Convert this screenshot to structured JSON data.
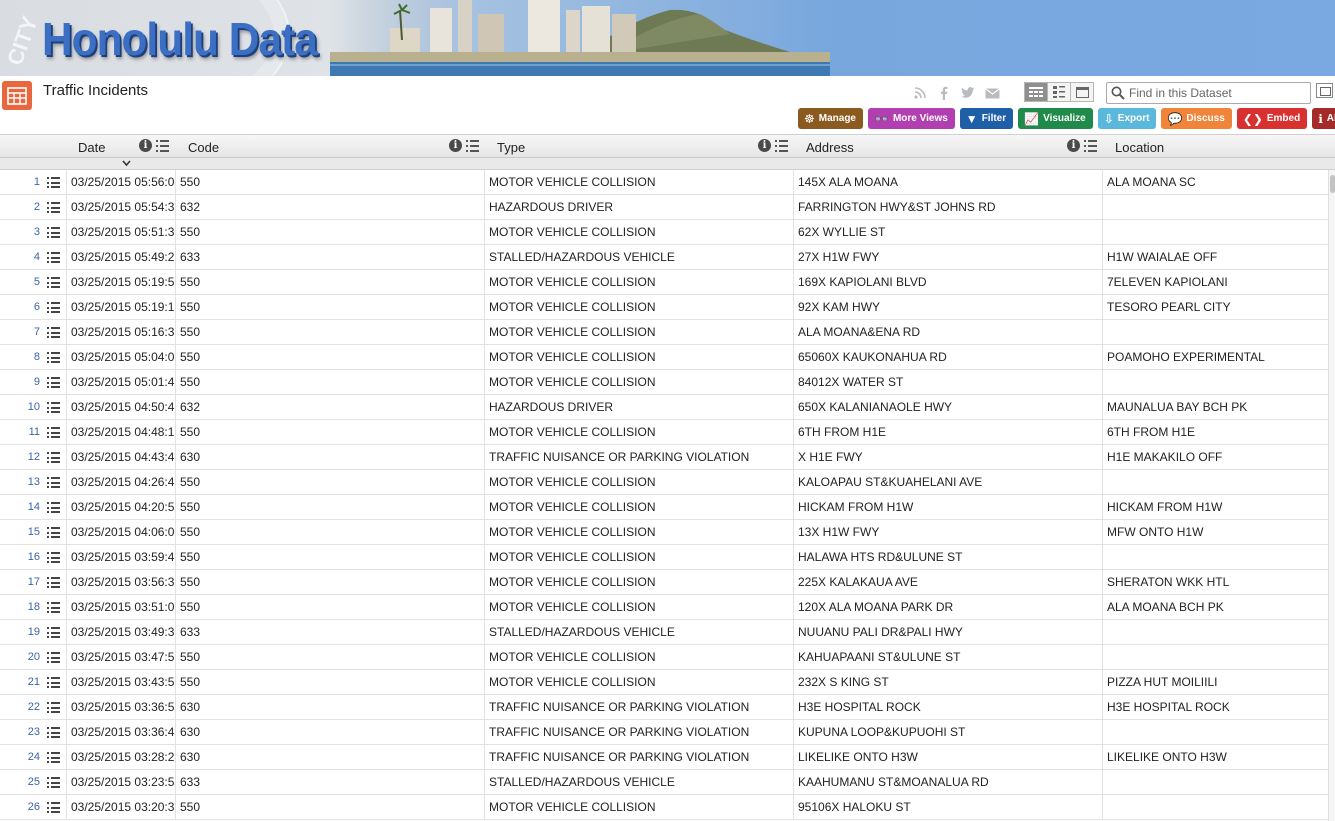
{
  "banner": {
    "title": "Honolulu Data",
    "seal_text": "CITY"
  },
  "page": {
    "title": "Traffic Incidents"
  },
  "share_icons": [
    "rss-icon",
    "facebook-icon",
    "twitter-icon",
    "email-icon"
  ],
  "search": {
    "placeholder": "Find in this Dataset"
  },
  "actions": [
    {
      "label": "Manage",
      "color": "#8b5a1f",
      "icon": "☸"
    },
    {
      "label": "More Views",
      "color": "#b23fb2",
      "icon": "👓"
    },
    {
      "label": "Filter",
      "color": "#1e5fa8",
      "icon": "▼"
    },
    {
      "label": "Visualize",
      "color": "#1f8a4a",
      "icon": "📈"
    },
    {
      "label": "Export",
      "color": "#5bb8dd",
      "icon": "⇩"
    },
    {
      "label": "Discuss",
      "color": "#f0843a",
      "icon": "💬"
    },
    {
      "label": "Embed",
      "color": "#d8312f",
      "icon": "❮❯"
    },
    {
      "label": "About",
      "color": "#a52a2a",
      "icon": "ℹ"
    }
  ],
  "columns": {
    "date": "Date",
    "code": "Code",
    "type": "Type",
    "address": "Address",
    "location": "Location"
  },
  "rows": [
    {
      "n": "1",
      "date": "03/25/2015 05:56:0",
      "code": "550",
      "type": "MOTOR VEHICLE COLLISION",
      "address": "145X ALA MOANA",
      "location": "ALA MOANA SC"
    },
    {
      "n": "2",
      "date": "03/25/2015 05:54:3",
      "code": "632",
      "type": "HAZARDOUS DRIVER",
      "address": "FARRINGTON HWY&ST JOHNS RD",
      "location": ""
    },
    {
      "n": "3",
      "date": "03/25/2015 05:51:3",
      "code": "550",
      "type": "MOTOR VEHICLE COLLISION",
      "address": "62X WYLLIE ST",
      "location": ""
    },
    {
      "n": "4",
      "date": "03/25/2015 05:49:2",
      "code": "633",
      "type": "STALLED/HAZARDOUS VEHICLE",
      "address": "27X H1W FWY",
      "location": "H1W WAIALAE OFF"
    },
    {
      "n": "5",
      "date": "03/25/2015 05:19:5",
      "code": "550",
      "type": "MOTOR VEHICLE COLLISION",
      "address": "169X KAPIOLANI BLVD",
      "location": "7ELEVEN KAPIOLANI"
    },
    {
      "n": "6",
      "date": "03/25/2015 05:19:1",
      "code": "550",
      "type": "MOTOR VEHICLE COLLISION",
      "address": "92X KAM HWY",
      "location": "TESORO PEARL CITY"
    },
    {
      "n": "7",
      "date": "03/25/2015 05:16:3",
      "code": "550",
      "type": "MOTOR VEHICLE COLLISION",
      "address": "ALA MOANA&ENA RD",
      "location": ""
    },
    {
      "n": "8",
      "date": "03/25/2015 05:04:0",
      "code": "550",
      "type": "MOTOR VEHICLE COLLISION",
      "address": "65060X KAUKONAHUA RD",
      "location": "POAMOHO EXPERIMENTAL"
    },
    {
      "n": "9",
      "date": "03/25/2015 05:01:4",
      "code": "550",
      "type": "MOTOR VEHICLE COLLISION",
      "address": "84012X WATER ST",
      "location": ""
    },
    {
      "n": "10",
      "date": "03/25/2015 04:50:4",
      "code": "632",
      "type": "HAZARDOUS DRIVER",
      "address": "650X KALANIANAOLE HWY",
      "location": "MAUNALUA BAY BCH PK"
    },
    {
      "n": "11",
      "date": "03/25/2015 04:48:1",
      "code": "550",
      "type": "MOTOR VEHICLE COLLISION",
      "address": "6TH FROM H1E",
      "location": "6TH FROM H1E"
    },
    {
      "n": "12",
      "date": "03/25/2015 04:43:4",
      "code": "630",
      "type": "TRAFFIC NUISANCE OR PARKING VIOLATION",
      "address": "X H1E FWY",
      "location": "H1E MAKAKILO OFF"
    },
    {
      "n": "13",
      "date": "03/25/2015 04:26:4",
      "code": "550",
      "type": "MOTOR VEHICLE COLLISION",
      "address": "KALOAPAU ST&KUAHELANI AVE",
      "location": ""
    },
    {
      "n": "14",
      "date": "03/25/2015 04:20:5",
      "code": "550",
      "type": "MOTOR VEHICLE COLLISION",
      "address": "HICKAM FROM H1W",
      "location": "HICKAM FROM H1W"
    },
    {
      "n": "15",
      "date": "03/25/2015 04:06:0",
      "code": "550",
      "type": "MOTOR VEHICLE COLLISION",
      "address": "13X H1W FWY",
      "location": "MFW ONTO H1W"
    },
    {
      "n": "16",
      "date": "03/25/2015 03:59:4",
      "code": "550",
      "type": "MOTOR VEHICLE COLLISION",
      "address": "HALAWA HTS RD&ULUNE ST",
      "location": ""
    },
    {
      "n": "17",
      "date": "03/25/2015 03:56:3",
      "code": "550",
      "type": "MOTOR VEHICLE COLLISION",
      "address": "225X KALAKAUA AVE",
      "location": "SHERATON WKK HTL"
    },
    {
      "n": "18",
      "date": "03/25/2015 03:51:0",
      "code": "550",
      "type": "MOTOR VEHICLE COLLISION",
      "address": "120X ALA MOANA PARK DR",
      "location": "ALA MOANA BCH PK"
    },
    {
      "n": "19",
      "date": "03/25/2015 03:49:3",
      "code": "633",
      "type": "STALLED/HAZARDOUS VEHICLE",
      "address": "NUUANU PALI DR&PALI HWY",
      "location": ""
    },
    {
      "n": "20",
      "date": "03/25/2015 03:47:5",
      "code": "550",
      "type": "MOTOR VEHICLE COLLISION",
      "address": "KAHUAPAANI ST&ULUNE ST",
      "location": ""
    },
    {
      "n": "21",
      "date": "03/25/2015 03:43:5",
      "code": "550",
      "type": "MOTOR VEHICLE COLLISION",
      "address": "232X S KING ST",
      "location": "PIZZA HUT MOILIILI"
    },
    {
      "n": "22",
      "date": "03/25/2015 03:36:5",
      "code": "630",
      "type": "TRAFFIC NUISANCE OR PARKING VIOLATION",
      "address": "H3E HOSPITAL ROCK",
      "location": "H3E HOSPITAL ROCK"
    },
    {
      "n": "23",
      "date": "03/25/2015 03:36:4",
      "code": "630",
      "type": "TRAFFIC NUISANCE OR PARKING VIOLATION",
      "address": "KUPUNA LOOP&KUPUOHI ST",
      "location": ""
    },
    {
      "n": "24",
      "date": "03/25/2015 03:28:2",
      "code": "630",
      "type": "TRAFFIC NUISANCE OR PARKING VIOLATION",
      "address": "LIKELIKE ONTO H3W",
      "location": "LIKELIKE ONTO H3W"
    },
    {
      "n": "25",
      "date": "03/25/2015 03:23:5",
      "code": "633",
      "type": "STALLED/HAZARDOUS VEHICLE",
      "address": "KAAHUMANU ST&MOANALUA RD",
      "location": ""
    },
    {
      "n": "26",
      "date": "03/25/2015 03:20:3",
      "code": "550",
      "type": "MOTOR VEHICLE COLLISION",
      "address": "95106X HALOKU ST",
      "location": ""
    }
  ]
}
